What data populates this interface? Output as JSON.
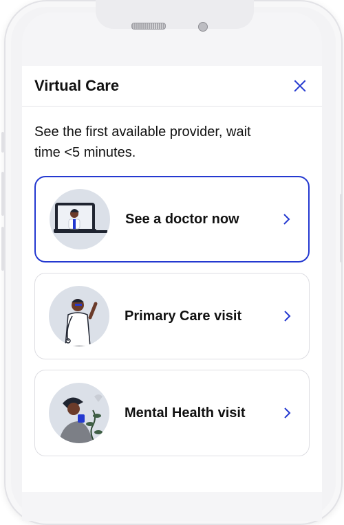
{
  "sheet": {
    "title": "Virtual Care",
    "intro": "See the first available provider, wait time <5 minutes."
  },
  "options": [
    {
      "label": "See a doctor now",
      "icon": "video-doctor-illustration",
      "selected": true
    },
    {
      "label": "Primary Care visit",
      "icon": "primary-care-doctor-illustration",
      "selected": false
    },
    {
      "label": "Mental Health visit",
      "icon": "mental-health-illustration",
      "selected": false
    }
  ],
  "colors": {
    "accent": "#2439d0",
    "avatar_bg": "#dbe0e8"
  }
}
